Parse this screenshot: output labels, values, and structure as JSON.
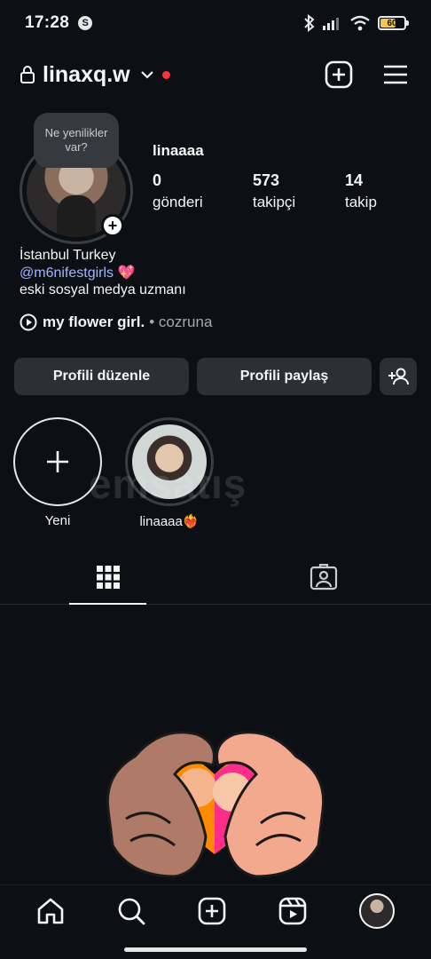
{
  "status_bar": {
    "time": "17:28",
    "battery": "60"
  },
  "header": {
    "username": "linaxq.w"
  },
  "profile": {
    "note": "Ne yenilikler var?",
    "display_name": "linaaaa",
    "stats": [
      {
        "value": "0",
        "label": "gönderi"
      },
      {
        "value": "573",
        "label": "takipçi"
      },
      {
        "value": "14",
        "label": "takip"
      }
    ],
    "bio_line1": "İstanbul Turkey",
    "bio_mention": "@m6nifestgirls",
    "bio_line3": "eski sosyal medya uzmanı",
    "music_song": "my flower girl.",
    "music_artist": "• cozruna"
  },
  "buttons": {
    "edit_profile": "Profili düzenle",
    "share_profile": "Profili paylaş"
  },
  "highlights": [
    {
      "label": "Yeni"
    },
    {
      "label": "linaaaa❤️‍🔥"
    }
  ],
  "watermark": "emsatış",
  "colors": {
    "background": "#0c1014",
    "button": "#2b3036",
    "mention": "#a3b4ff",
    "notification": "#ff3040"
  }
}
